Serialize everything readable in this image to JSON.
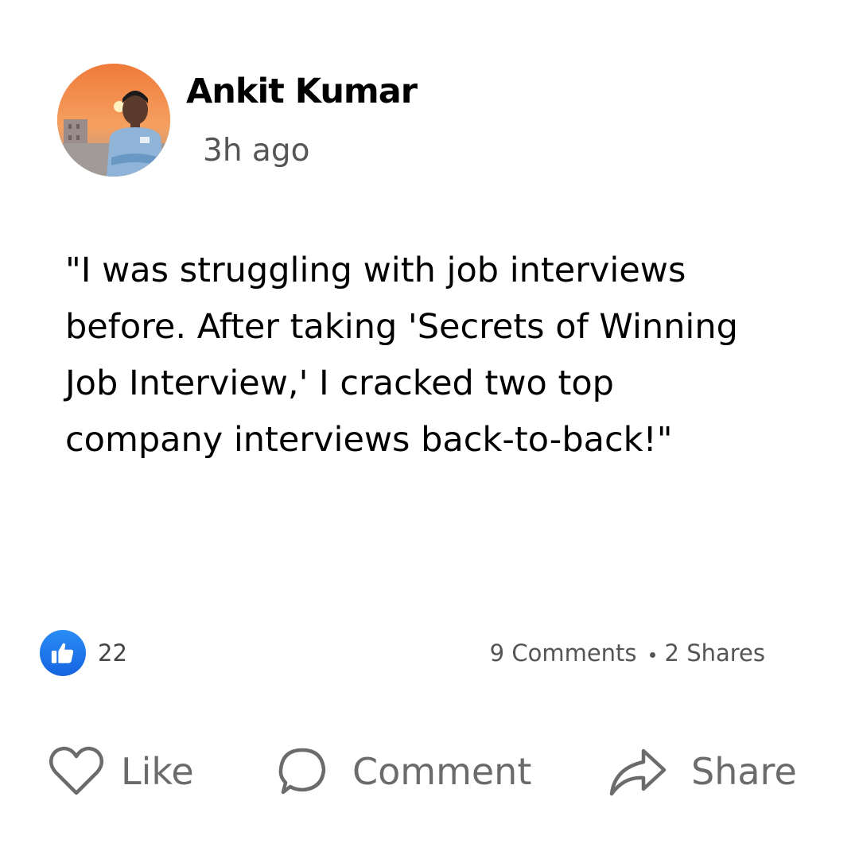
{
  "post": {
    "author": {
      "name": "Ankit Kumar",
      "timestamp": "3h ago"
    },
    "body_lines": [
      "\"I was struggling with job interviews",
      "before. After taking 'Secrets of Winning",
      "Job Interview,' I cracked two top",
      "company interviews back-to-back!\""
    ],
    "reactions": {
      "like_count": "22",
      "comments": "9 Comments",
      "shares": "2 Shares",
      "like_badge_color": "#1877F2"
    },
    "actions": {
      "like": "Like",
      "comment": "Comment",
      "share": "Share"
    }
  }
}
